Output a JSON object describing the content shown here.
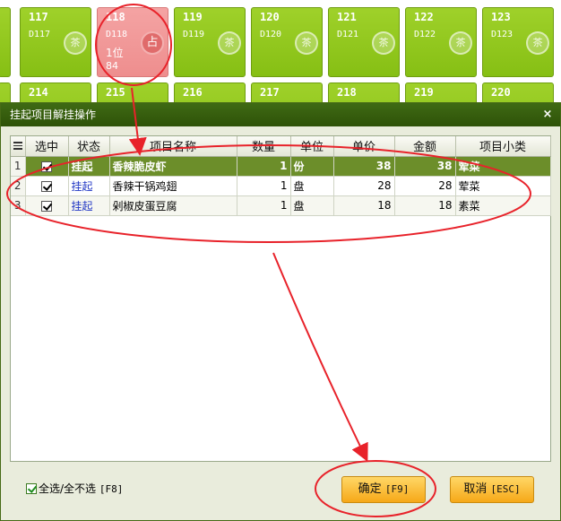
{
  "tables_row1": [
    {
      "num": "",
      "code": "",
      "edge": true
    },
    {
      "num": "117",
      "code": "D117"
    },
    {
      "num": "118",
      "code": "D118",
      "occupied": true,
      "capacity": "1位",
      "guests": "84",
      "badge": "占"
    },
    {
      "num": "119",
      "code": "D119"
    },
    {
      "num": "120",
      "code": "D120"
    },
    {
      "num": "121",
      "code": "D121"
    },
    {
      "num": "122",
      "code": "D122"
    },
    {
      "num": "123",
      "code": "D123"
    }
  ],
  "tables_row2": [
    "214",
    "215",
    "216",
    "217",
    "218",
    "219",
    "220"
  ],
  "tile_mark": "茶",
  "dialog": {
    "title": "挂起项目解挂操作",
    "close_label": "×",
    "columns": [
      "",
      "选中",
      "状态",
      "项目名称",
      "数量",
      "单位",
      "单价",
      "金额",
      "项目小类"
    ],
    "rows": [
      {
        "no": "1",
        "checked": true,
        "status": "挂起",
        "name": "香辣脆皮虾",
        "qty": "1",
        "unit": "份",
        "price": "38",
        "amount": "38",
        "category": "荤菜"
      },
      {
        "no": "2",
        "checked": true,
        "status": "挂起",
        "name": "香辣干锅鸡翅",
        "qty": "1",
        "unit": "盘",
        "price": "28",
        "amount": "28",
        "category": "荤菜"
      },
      {
        "no": "3",
        "checked": true,
        "status": "挂起",
        "name": "剁椒皮蛋豆腐",
        "qty": "1",
        "unit": "盘",
        "price": "18",
        "amount": "18",
        "category": "素菜"
      }
    ],
    "select_all_label": "全选/全不选",
    "select_all_key": "[F8]",
    "ok_label": "确定",
    "ok_key": "[F9]",
    "cancel_label": "取消",
    "cancel_key": "[ESC]"
  },
  "colors": {
    "tile_green": "#8cc418",
    "tile_occupied": "#f09a9a",
    "titlebar": "#365f0e",
    "selected_row": "#6c8e2a",
    "button_orange": "#f8b326",
    "annotation_red": "#e8222a"
  }
}
